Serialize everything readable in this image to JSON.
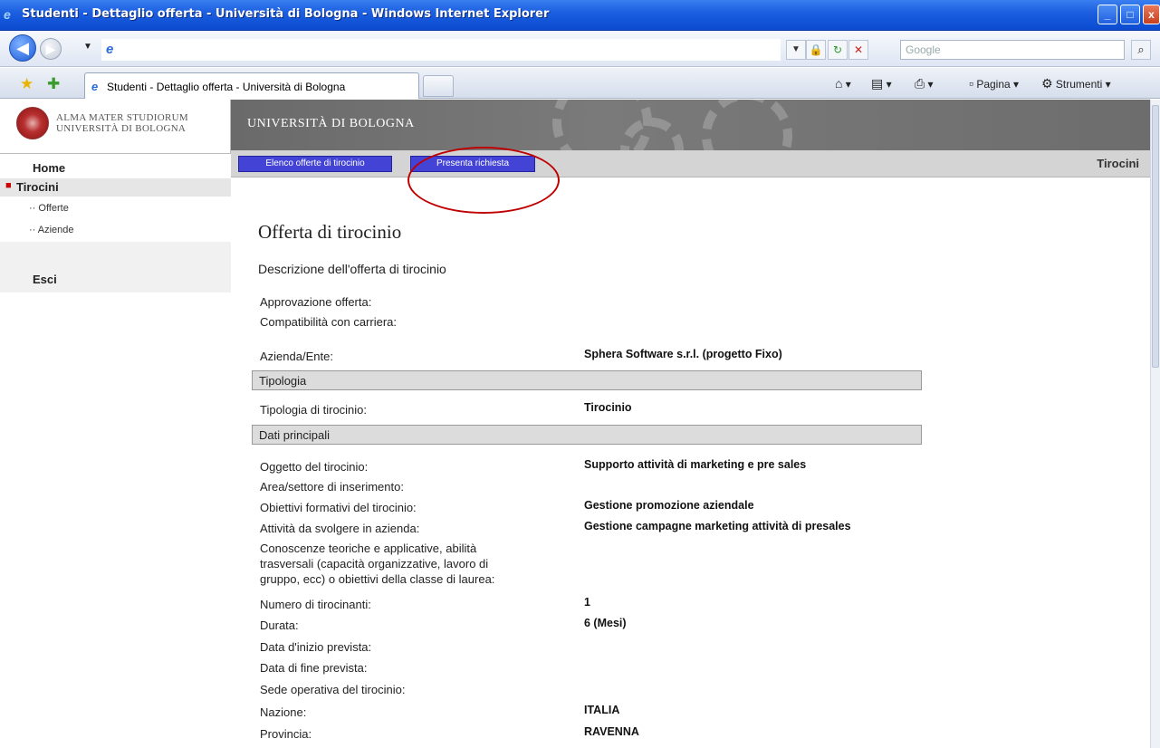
{
  "window": {
    "title": "Studenti - Dettaglio offerta - Università di Bologna - Windows Internet Explorer",
    "buttons": {
      "minimize": "_",
      "maximize": "□",
      "close": "x"
    }
  },
  "addressbar": {
    "url": "",
    "search_placeholder": "Google"
  },
  "tabbar": {
    "tab_title": "Studenti - Dettaglio offerta - Università di Bologna",
    "page_menu": "Pagina",
    "tools_menu": "Strumenti"
  },
  "site": {
    "logo_line1": "ALMA MATER STUDIORUM",
    "logo_line2": "UNIVERSITÀ DI BOLOGNA",
    "banner_title": "UNIVERSITÀ DI BOLOGNA"
  },
  "sidebar": {
    "home": "Home",
    "tirocini": "Tirocini",
    "offerte": "·· Offerte",
    "aziende": "·· Aziende",
    "esci": "Esci"
  },
  "topnav": {
    "btn_elenco": "Elenco offerte di tirocinio",
    "btn_presenta": "Presenta richiesta",
    "section_label": "Tirocini"
  },
  "content": {
    "title": "Offerta di tirocinio",
    "subtitle": "Descrizione dell'offerta di tirocinio",
    "rows": [
      {
        "label": "Approvazione offerta:",
        "value": ""
      },
      {
        "label": "Compatibilità con carriera:",
        "value": ""
      },
      {
        "label": "Azienda/Ente:",
        "value": "Sphera Software s.r.l. (progetto Fixo)"
      },
      {
        "label": "Tipologia di tirocinio:",
        "value": "Tirocinio"
      },
      {
        "label": "Oggetto del tirocinio:",
        "value": "Supporto attività di marketing e pre sales"
      },
      {
        "label": "Area/settore di inserimento:",
        "value": ""
      },
      {
        "label": "Obiettivi formativi del tirocinio:",
        "value": "Gestione promozione aziendale"
      },
      {
        "label": "Attività da svolgere in azienda:",
        "value": "Gestione campagne marketing attività di presales"
      },
      {
        "label": "Conoscenze teoriche e applicative, abilità",
        "value": ""
      },
      {
        "label": "trasversali (capacità organizzative, lavoro di",
        "value": ""
      },
      {
        "label": "gruppo, ecc) o obiettivi della classe di laurea:",
        "value": ""
      },
      {
        "label": "Numero di tirocinanti:",
        "value": "1"
      },
      {
        "label": "Durata:",
        "value": "6 (Mesi)"
      },
      {
        "label": "Data d'inizio prevista:",
        "value": ""
      },
      {
        "label": "Data di fine prevista:",
        "value": ""
      },
      {
        "label": "Sede operativa del tirocinio:",
        "value": ""
      },
      {
        "label": "Nazione:",
        "value": "ITALIA"
      },
      {
        "label": "Provincia:",
        "value": "RAVENNA"
      }
    ],
    "sections": [
      "Tipologia",
      "Dati principali"
    ]
  }
}
